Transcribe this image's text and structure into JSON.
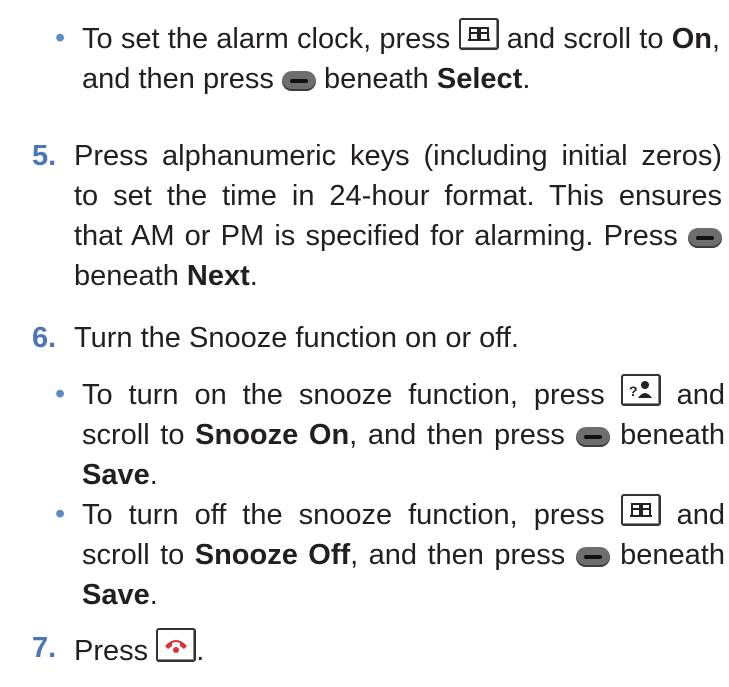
{
  "item_a": {
    "p1": "To set the alarm clock, press",
    "p2": "and scroll to",
    "b1": "On",
    "p3": ", and then press",
    "p4": "beneath",
    "b2": "Select",
    "p5": "."
  },
  "step5": {
    "num": "5.",
    "text": "Press alphanumeric keys (including initial zeros) to set the time in 24-hour format. This ensures that AM or PM is specified for alarming. Press",
    "p2": "beneath",
    "b1": "Next",
    "p3": "."
  },
  "step6": {
    "num": "6.",
    "text": "Turn the Snooze function on or off."
  },
  "item_on": {
    "p1": "To turn on the snooze function, press",
    "p2": "and scroll to",
    "b1": "Snooze On",
    "p3": ", and then press",
    "p4": "beneath",
    "b2": "Save",
    "p5": "."
  },
  "item_off": {
    "p1": "To turn off the snooze function, press",
    "p2": "and scroll to",
    "b1": "Snooze Off",
    "p3": ", and then press",
    "p4": "beneath",
    "b2": "Save",
    "p5": "."
  },
  "step7": {
    "num": "7.",
    "text": "Press",
    "end": "."
  },
  "bullet_char": "•",
  "icons": {
    "phonebook": "phonebook-key-icon",
    "contacts": "contacts-key-icon",
    "softkey": "soft-key-icon",
    "end_call": "end-call-key-icon"
  },
  "colors": {
    "step_number": "#4a76b8",
    "bullet": "#5b8cc6",
    "end_call_icon": "#d9303a"
  }
}
